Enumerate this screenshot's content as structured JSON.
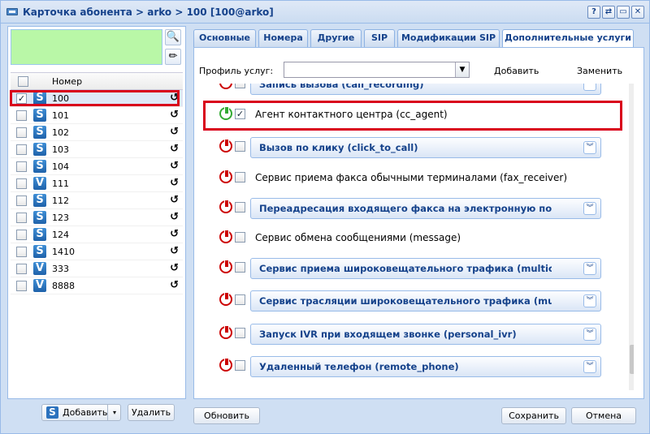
{
  "window": {
    "title": "Карточка абонента > arko > 100 [100@arko]",
    "buttons": [
      "?",
      "⇄",
      "▭",
      "✕"
    ]
  },
  "left": {
    "header_label": "Номер",
    "rows": [
      {
        "number": "100",
        "type": "S",
        "checked": true
      },
      {
        "number": "101",
        "type": "S",
        "checked": false
      },
      {
        "number": "102",
        "type": "S",
        "checked": false
      },
      {
        "number": "103",
        "type": "S",
        "checked": false
      },
      {
        "number": "104",
        "type": "S",
        "checked": false
      },
      {
        "number": "111",
        "type": "V",
        "checked": false
      },
      {
        "number": "112",
        "type": "S",
        "checked": false
      },
      {
        "number": "123",
        "type": "S",
        "checked": false
      },
      {
        "number": "124",
        "type": "S",
        "checked": false
      },
      {
        "number": "1410",
        "type": "S",
        "checked": false
      },
      {
        "number": "333",
        "type": "V",
        "checked": false
      },
      {
        "number": "8888",
        "type": "V",
        "checked": false
      }
    ],
    "add_label": "Добавить",
    "delete_label": "Удалить"
  },
  "tabs": [
    "Основные",
    "Номера",
    "Другие",
    "SIP",
    "Модификации SIP",
    "Дополнительные услуги"
  ],
  "profile": {
    "label": "Профиль услуг:",
    "add": "Добавить",
    "replace": "Заменить"
  },
  "services": [
    {
      "label": "Запись вызова (call_recording)",
      "kind": "panel",
      "active": false,
      "checked": false
    },
    {
      "label": "Агент контактного центра (cc_agent)",
      "kind": "plain",
      "active": true,
      "checked": true
    },
    {
      "label": "Вызов по клику (click_to_call)",
      "kind": "panel",
      "active": false,
      "checked": false
    },
    {
      "label": "Сервис приема факса обычными терминалами (fax_receiver)",
      "kind": "plain",
      "active": false,
      "checked": false
    },
    {
      "label": "Переадресация входящего факса на электронную почту (fax_",
      "kind": "panel",
      "active": false,
      "checked": false
    },
    {
      "label": "Сервис обмена сообщениями (message)",
      "kind": "plain",
      "active": false,
      "checked": false
    },
    {
      "label": "Сервис приема широковещательного трафика (multicast_liste",
      "kind": "panel",
      "active": false,
      "checked": false
    },
    {
      "label": "Сервис трасляции широковещательного трафика (multicast_p",
      "kind": "panel",
      "active": false,
      "checked": false
    },
    {
      "label": "Запуск IVR при входящем звонке (personal_ivr)",
      "kind": "panel",
      "active": false,
      "checked": false
    },
    {
      "label": "Удаленный телефон (remote_phone)",
      "kind": "panel",
      "active": false,
      "checked": false
    }
  ],
  "footer": {
    "refresh": "Обновить",
    "save": "Сохранить",
    "cancel": "Отмена"
  }
}
